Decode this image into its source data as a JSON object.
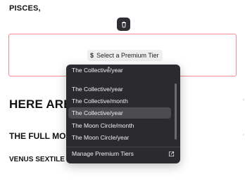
{
  "page": {
    "heading_top": "PISCES,",
    "heading_big": "HERE ARE T",
    "heading_mid": "THE FULL MOO",
    "heading_small": "VENUS SEXTILE",
    "right_mark_1": "‹",
    "right_mark_2": "‹"
  },
  "paywall": {
    "button_label": "Select a Premium Tier",
    "button_icon": "dollar-icon",
    "delete_icon": "trash-icon"
  },
  "dropdown": {
    "items": [
      "The Collective/year",
      "The Collective/year",
      "The Collective/month",
      "The Collective/year",
      "The Moon Circle/month",
      "The Moon Circle/year"
    ],
    "selected_index": 3,
    "footer_label": "Manage Premium Tiers",
    "footer_icon": "external-link-icon"
  },
  "colors": {
    "accent_border": "#f08a94",
    "dropdown_bg": "#2b2b2f",
    "selected_bg": "#4b4b50"
  }
}
